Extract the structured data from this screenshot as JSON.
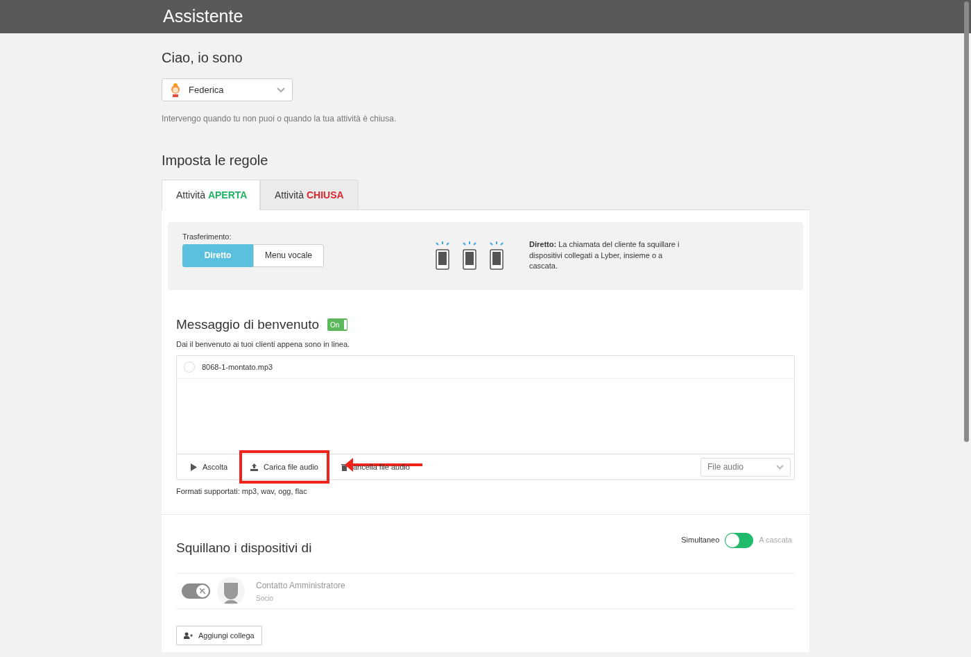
{
  "header": {
    "title": "Assistente"
  },
  "intro": {
    "heading": "Ciao, io sono",
    "assistant_select": {
      "value": "Federica"
    },
    "description": "Intervengo quando tu non puoi o quando la tua attività è chiusa."
  },
  "rules": {
    "heading": "Imposta le regole",
    "tabs": [
      {
        "label": "Attività",
        "status": "APERTA",
        "color": "#1fb462",
        "selected": true
      },
      {
        "label": "Attività",
        "status": "CHIUSA",
        "color": "#e0262b",
        "selected": false
      }
    ],
    "transfer": {
      "label": "Trasferimento:",
      "options": [
        {
          "label": "Diretto",
          "selected": true
        },
        {
          "label": "Menu vocale",
          "selected": false
        }
      ],
      "explanation": "**Diretto:** La chiamata del cliente fa squillare i dispositivi collegati a Lyber, insieme o a cascata."
    },
    "welcome": {
      "heading": "Messaggio di benvenuto",
      "toggle": {
        "label": "On",
        "on": true
      },
      "description": "Dai il benvenuto ai tuoi clienti appena sono in linea.",
      "files": [
        {
          "name": "8068-1-montato.mp3",
          "selected": false
        }
      ],
      "actions": [
        {
          "kind": "play",
          "label": "Ascolta"
        },
        {
          "kind": "upload",
          "label": "Carica file audio",
          "highlighted": true
        },
        {
          "kind": "delete",
          "label": "ancella file audio"
        }
      ],
      "source_select": {
        "value": "File audio"
      },
      "formats": "Formati supportati: mp3, wav, ogg, flac"
    },
    "devices": {
      "heading": "Squillano i dispositivi di",
      "mode": {
        "left_label": "Simultaneo",
        "right_label": "A cascata",
        "right_selected": false
      },
      "members": [
        {
          "name": "Contatto Amministratore",
          "role": "Socio",
          "on": false
        }
      ],
      "add_button": "Aggiungi collega"
    }
  }
}
